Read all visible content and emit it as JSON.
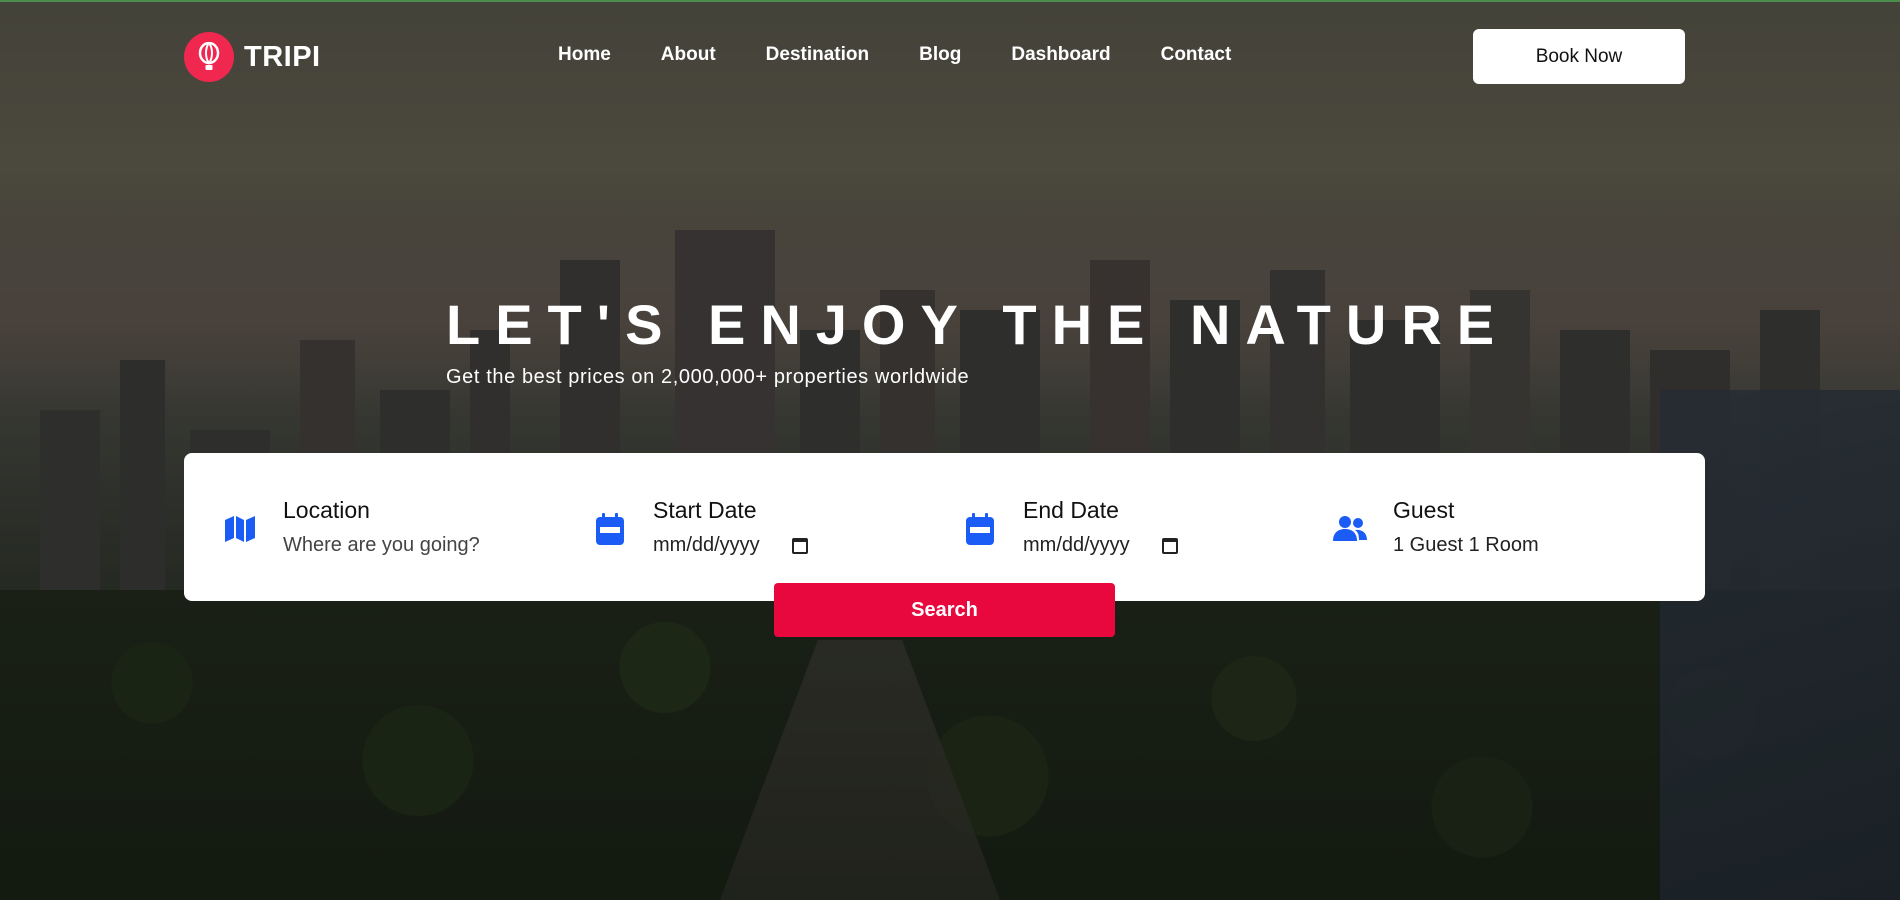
{
  "brand": {
    "name": "TRIPI",
    "accent": "#f0274f"
  },
  "nav": {
    "items": [
      {
        "label": "Home"
      },
      {
        "label": "About"
      },
      {
        "label": "Destination"
      },
      {
        "label": "Blog"
      },
      {
        "label": "Dashboard"
      },
      {
        "label": "Contact"
      }
    ],
    "cta_label": "Book Now"
  },
  "hero": {
    "title": "LET'S ENJOY THE NATURE",
    "subtitle": "Get the best prices on 2,000,000+ properties worldwide"
  },
  "search": {
    "fields": [
      {
        "icon": "map-icon",
        "label": "Location",
        "placeholder": "Where are you going?"
      },
      {
        "icon": "calendar-icon",
        "label": "Start Date",
        "value": "mm/dd/yyyy"
      },
      {
        "icon": "calendar-icon",
        "label": "End Date",
        "value": "mm/dd/yyyy"
      },
      {
        "icon": "users-icon",
        "label": "Guest",
        "value": "1 Guest 1 Room"
      }
    ],
    "button_label": "Search",
    "icon_color": "#1a5cf5",
    "button_color": "#e8083e"
  }
}
